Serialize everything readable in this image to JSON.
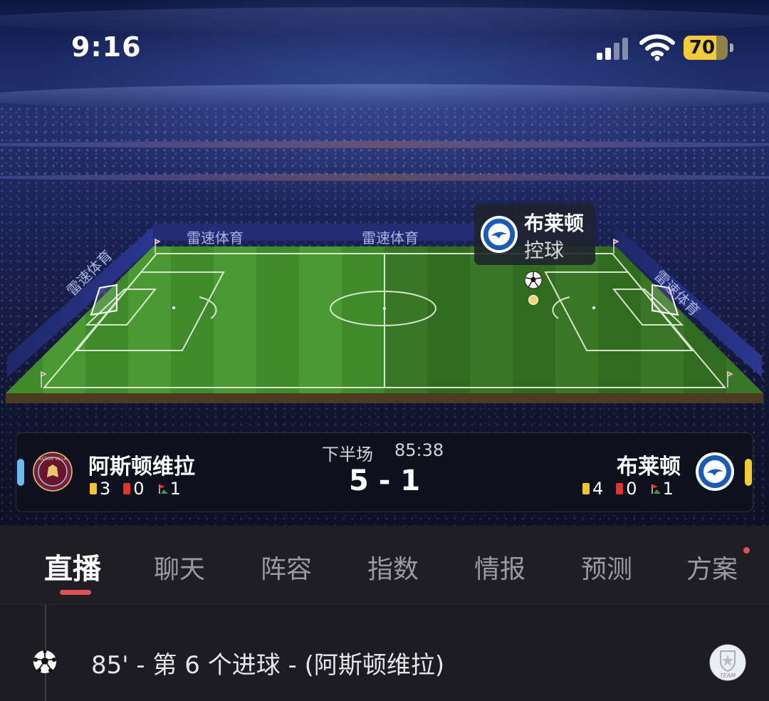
{
  "status_bar": {
    "time": "9:16",
    "battery": "70"
  },
  "pitch": {
    "board_ad": "雷速体育",
    "possession_popup": {
      "team": "布莱顿",
      "status": "控球"
    }
  },
  "match": {
    "period": "下半场",
    "clock": "85:38",
    "score": "5 - 1",
    "home": {
      "name": "阿斯顿维拉",
      "yellow_cards": "3",
      "red_cards": "0",
      "corners": "1",
      "color": "#6fb8f0",
      "crest_text": "ASTON VILLA"
    },
    "away": {
      "name": "布莱顿",
      "yellow_cards": "4",
      "red_cards": "0",
      "corners": "1",
      "color": "#f2cb3a",
      "crest_text": "BRIGHTON & HOVE ALBION"
    }
  },
  "tabs": [
    "直播",
    "聊天",
    "阵容",
    "指数",
    "情报",
    "预测",
    "方案"
  ],
  "active_tab": "直播",
  "events": [
    {
      "text": "85' - 第 6 个进球 - (阿斯顿维拉)",
      "badge": "TEAM"
    }
  ]
}
